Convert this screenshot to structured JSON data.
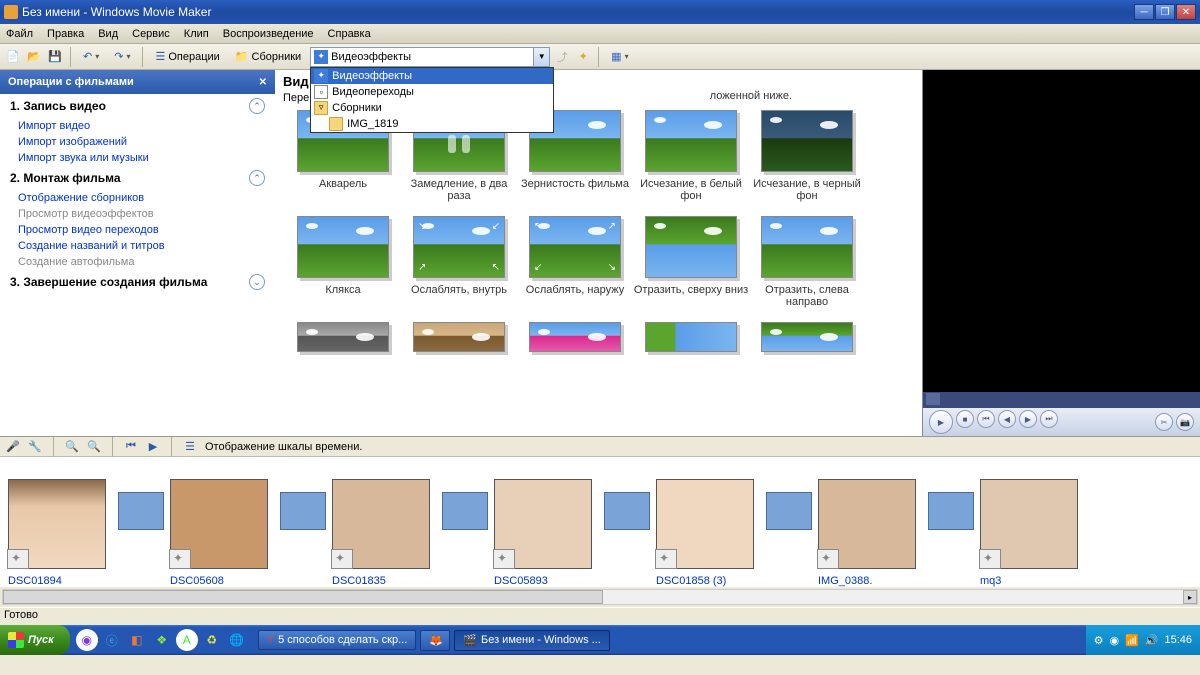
{
  "title": "Без имени - Windows Movie Maker",
  "menu": [
    "Файл",
    "Правка",
    "Вид",
    "Сервис",
    "Клип",
    "Воспроизведение",
    "Справка"
  ],
  "toolbar": {
    "tasks": "Операции",
    "collections": "Сборники",
    "combo_selected": "Видеоэффекты"
  },
  "dropdown": {
    "items": [
      "Видеоэффекты",
      "Видеопереходы",
      "Сборники",
      "IMG_1819"
    ]
  },
  "sidebar": {
    "header": "Операции с фильмами",
    "section1": {
      "title": "1. Запись видео",
      "links": [
        "Импорт видео",
        "Импорт изображений",
        "Импорт звука или музыки"
      ]
    },
    "section2": {
      "title": "2. Монтаж фильма",
      "links": [
        "Отображение сборников",
        "Просмотр видеоэффектов",
        "Просмотр видео переходов",
        "Создание названий и титров",
        "Создание автофильма"
      ],
      "grayed": [
        1,
        4
      ]
    },
    "section3": {
      "title": "3. Завершение создания фильма"
    }
  },
  "main": {
    "subtitle_partial": "ложенной ниже.",
    "heading_partial": "Вид",
    "sub_partial": "Пере"
  },
  "effects": [
    {
      "label": "Акварель",
      "cls": ""
    },
    {
      "label": "Замедление, в два раза",
      "cls": "",
      "people": true
    },
    {
      "label": "Зернистость фильма",
      "cls": ""
    },
    {
      "label": "Исчезание, в белый фон",
      "cls": ""
    },
    {
      "label": "Исчезание, в черный фон",
      "cls": "dark"
    },
    {
      "label": "Клякса",
      "cls": ""
    },
    {
      "label": "Ослаблять, внутрь",
      "cls": "",
      "arrows": "in"
    },
    {
      "label": "Ослаблять, наружу",
      "cls": "",
      "arrows": "out"
    },
    {
      "label": "Отразить, сверху вниз",
      "cls": "flip"
    },
    {
      "label": "Отразить, слева направо",
      "cls": ""
    },
    {
      "label": "",
      "cls": "gray",
      "partial": true
    },
    {
      "label": "",
      "cls": "sepia",
      "partial": true
    },
    {
      "label": "",
      "cls": "pink",
      "partial": true
    },
    {
      "label": "",
      "cls": "half",
      "partial": true
    },
    {
      "label": "",
      "cls": "flip",
      "partial": true
    }
  ],
  "timeline": {
    "toolbar_label": "Отображение шкалы времени.",
    "clips": [
      "DSC01894",
      "DSC05608",
      "DSC01835",
      "DSC05893",
      "DSC01858 (3)",
      "IMG_0388.",
      "mq3"
    ]
  },
  "status": "Готово",
  "taskbar": {
    "start": "Пуск",
    "tasks": [
      {
        "label": "5 способов сделать скр...",
        "active": false
      },
      {
        "label": "",
        "active": false,
        "icon_only": true
      },
      {
        "label": "Без имени - Windows ...",
        "active": true
      }
    ],
    "clock": "15:46"
  }
}
